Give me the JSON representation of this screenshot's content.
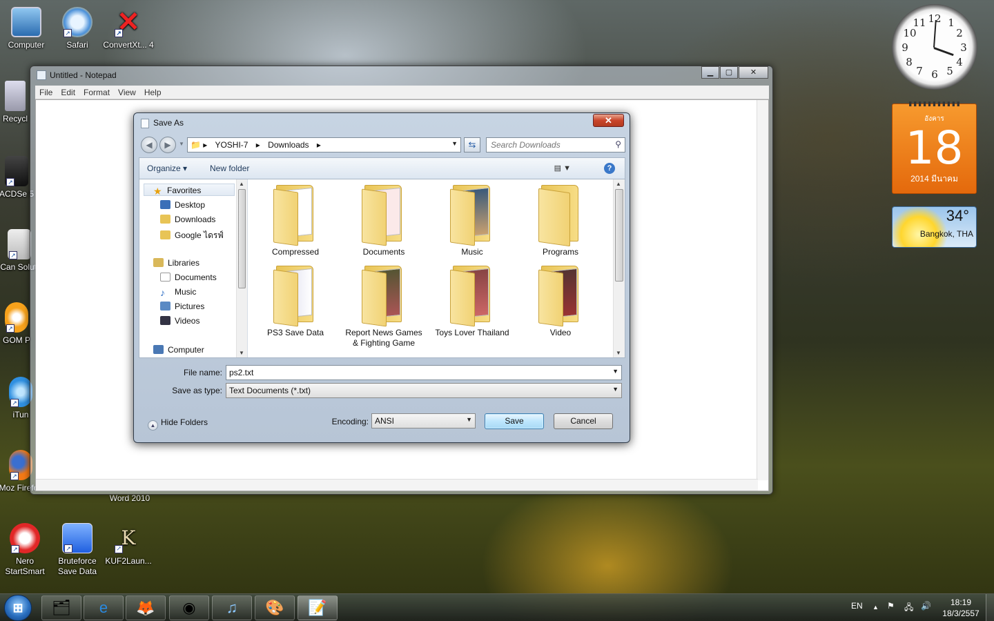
{
  "desktop": {
    "icons": [
      {
        "label": "Computer"
      },
      {
        "label": "Safari"
      },
      {
        "label": "ConvertXt... 4"
      },
      {
        "label": "Recycl"
      },
      {
        "label": "ACDSe 5"
      },
      {
        "label": "Can Soluti"
      },
      {
        "label": "GOM P"
      },
      {
        "label": "iTun"
      },
      {
        "label": "Moz Firefox"
      },
      {
        "label": "Word 2010"
      },
      {
        "label": "Nero StartSmart"
      },
      {
        "label": "Bruteforce Save Data"
      },
      {
        "label": "KUF2Laun..."
      }
    ]
  },
  "notepad": {
    "title": "Untitled - Notepad",
    "menu": [
      "File",
      "Edit",
      "Format",
      "View",
      "Help"
    ]
  },
  "dialog": {
    "title": "Save As",
    "close": "✕",
    "breadcrumb": [
      "YOSHI-7",
      "Downloads"
    ],
    "search_placeholder": "Search Downloads",
    "toolbar": {
      "organize": "Organize ▾",
      "new_folder": "New folder",
      "help": "?"
    },
    "nav": {
      "favorites": "Favorites",
      "desktop": "Desktop",
      "downloads": "Downloads",
      "google_drive": "Google ไดรฟ์",
      "libraries": "Libraries",
      "documents": "Documents",
      "music": "Music",
      "pictures": "Pictures",
      "videos": "Videos",
      "computer": "Computer"
    },
    "files": [
      {
        "name": "Compressed"
      },
      {
        "name": "Documents"
      },
      {
        "name": "Music"
      },
      {
        "name": "Programs"
      },
      {
        "name": "PS3 Save Data"
      },
      {
        "name": "Report News Games & Fighting Game"
      },
      {
        "name": "Toys Lover Thailand"
      },
      {
        "name": "Video"
      }
    ],
    "file_name_label": "File name:",
    "file_name_value": "ps2.txt",
    "save_as_type_label": "Save as type:",
    "save_as_type_value": "Text Documents (*.txt)",
    "hide_folders": "Hide Folders",
    "encoding_label": "Encoding:",
    "encoding_value": "ANSI",
    "save": "Save",
    "cancel": "Cancel"
  },
  "gadgets": {
    "clock_numbers": [
      "12",
      "1",
      "2",
      "3",
      "4",
      "5",
      "6",
      "7",
      "8",
      "9",
      "10",
      "11"
    ],
    "calendar": {
      "month": "อังคาร",
      "day": "18",
      "year": "2014 มีนาคม"
    },
    "weather": {
      "temp": "34°",
      "city": "Bangkok, THA"
    }
  },
  "taskbar": {
    "lang": "EN",
    "time": "18:19",
    "date": "18/3/2557"
  }
}
